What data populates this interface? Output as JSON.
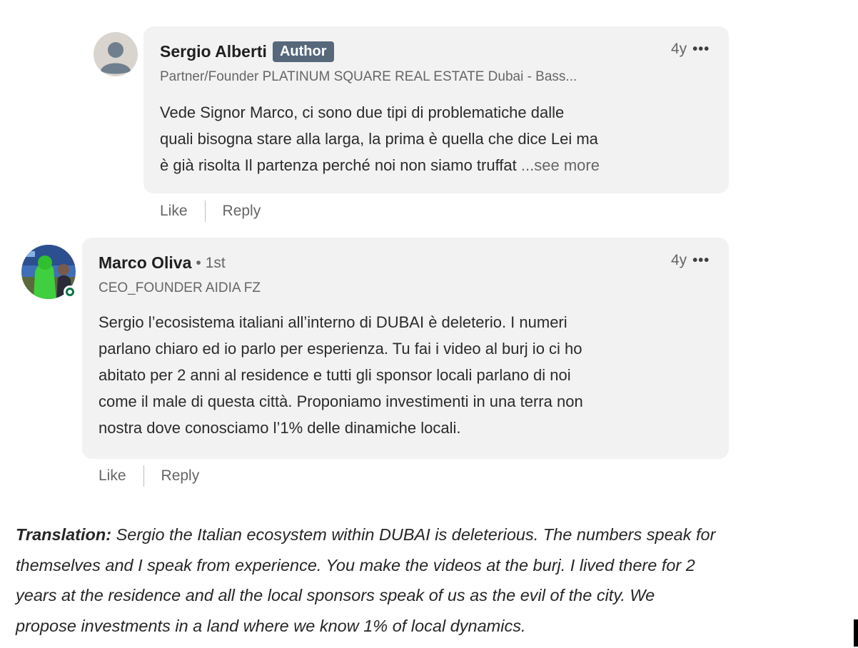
{
  "comments": [
    {
      "name": "Sergio Alberti",
      "badge": "Author",
      "degree": "",
      "headline": "Partner/Founder PLATINUM SQUARE REAL ESTATE Dubai - Bass...",
      "time": "4y",
      "more": "•••",
      "text_lines": [
        "Vede Signor Marco, ci sono due tipi di problematiche dalle",
        "quali bisogna stare alla larga, la prima è quella che dice Lei ma",
        "è già risolta Il partenza perché noi non siamo truffat"
      ],
      "see_more": "...see more",
      "like": "Like",
      "reply": "Reply"
    },
    {
      "name": "Marco Oliva",
      "badge": "",
      "degree_dot": "•",
      "degree": "1st",
      "headline": "CEO_FOUNDER AIDIA FZ",
      "time": "4y",
      "more": "•••",
      "text_lines": [
        "Sergio l’ecosistema italiani all’interno di DUBAI è deleterio. I numeri",
        "parlano chiaro ed io parlo per esperienza. Tu fai i video al burj io ci ho",
        "abitato per 2 anni al residence e tutti gli sponsor locali parlano di noi",
        "come il male di questa città. Proponiamo investimenti in una terra non",
        "nostra dove conosciamo l’1% delle dinamiche locali."
      ],
      "online": true,
      "like": "Like",
      "reply": "Reply"
    }
  ],
  "translation": {
    "label": "Translation:",
    "lines": [
      " Sergio the Italian ecosystem within DUBAI is deleterious. The numbers speak for",
      "themselves and I speak from experience. You make the videos at the burj. I lived there for 2",
      "years at the residence and all the local sponsors speak of us as the evil of the city. We",
      "propose investments in a land where we know 1% of local dynamics."
    ]
  },
  "colors": {
    "bubble": "#f2f2f2",
    "badge": "#56687a",
    "online": "#057642"
  },
  "icons": [
    "default-avatar-icon",
    "profile-photo",
    "online-status-icon",
    "more-options-icon"
  ]
}
